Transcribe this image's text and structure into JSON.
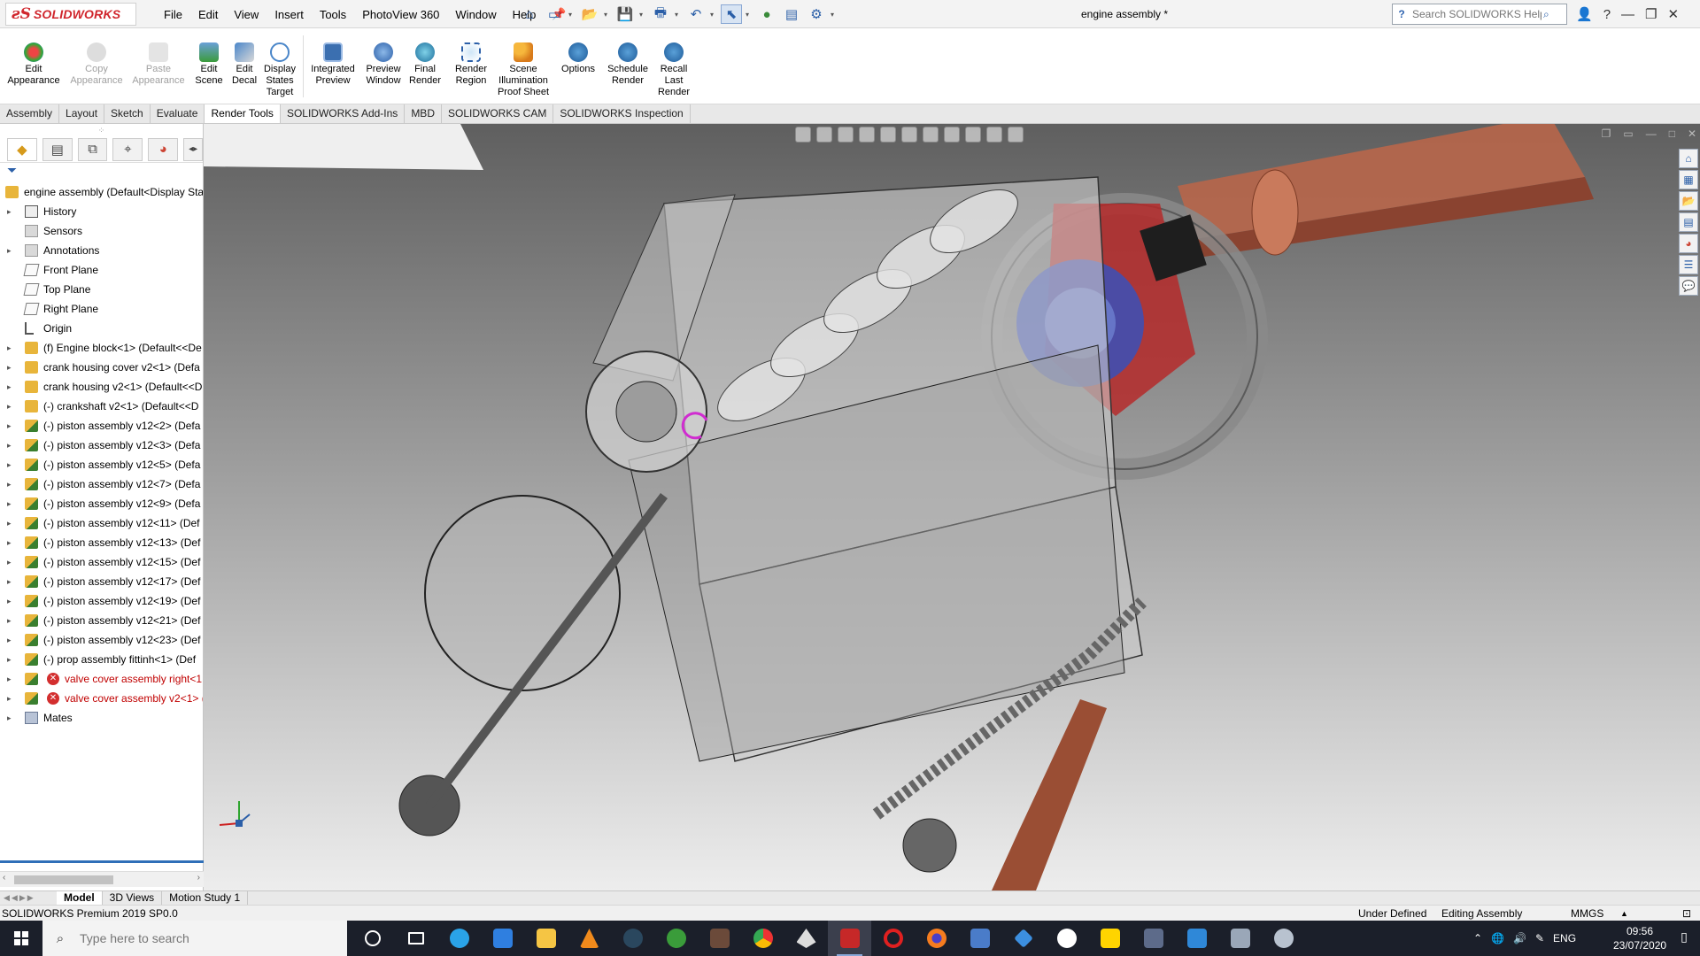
{
  "app": {
    "logo_text": "SOLIDWORKS",
    "menus": [
      "File",
      "Edit",
      "View",
      "Insert",
      "Tools",
      "PhotoView 360",
      "Window",
      "Help"
    ],
    "document_title": "engine assembly *",
    "help_search_placeholder": "Search SOLIDWORKS Help"
  },
  "command_manager": {
    "buttons": [
      {
        "label": "Edit\nAppearance",
        "icon": "edit-appearance-icon",
        "enabled": true
      },
      {
        "label": "Copy\nAppearance",
        "icon": "copy-appearance-icon",
        "enabled": false
      },
      {
        "label": "Paste\nAppearance",
        "icon": "paste-appearance-icon",
        "enabled": false
      },
      {
        "label": "Edit\nScene",
        "icon": "edit-scene-icon",
        "enabled": true
      },
      {
        "label": "Edit\nDecal",
        "icon": "edit-decal-icon",
        "enabled": true
      },
      {
        "label": "Display\nStates\nTarget",
        "icon": "display-states-icon",
        "enabled": true
      },
      {
        "label": "Integrated\nPreview",
        "icon": "integrated-preview-icon",
        "enabled": true
      },
      {
        "label": "Preview\nWindow",
        "icon": "preview-window-icon",
        "enabled": true
      },
      {
        "label": "Final\nRender",
        "icon": "final-render-icon",
        "enabled": true
      },
      {
        "label": "Render\nRegion",
        "icon": "render-region-icon",
        "enabled": true
      },
      {
        "label": "Scene\nIllumination\nProof Sheet",
        "icon": "scene-illumination-icon",
        "enabled": true
      },
      {
        "label": "Options",
        "icon": "options-icon",
        "enabled": true
      },
      {
        "label": "Schedule\nRender",
        "icon": "schedule-render-icon",
        "enabled": true
      },
      {
        "label": "Recall\nLast\nRender",
        "icon": "recall-render-icon",
        "enabled": true
      }
    ]
  },
  "tabs": [
    "Assembly",
    "Layout",
    "Sketch",
    "Evaluate",
    "Render Tools",
    "SOLIDWORKS Add-Ins",
    "MBD",
    "SOLIDWORKS CAM",
    "SOLIDWORKS Inspection"
  ],
  "active_tab": "Render Tools",
  "feature_tree": {
    "root": "engine assembly  (Default<Display Sta",
    "items": [
      {
        "label": "History",
        "icon": "history-icon",
        "expandable": true
      },
      {
        "label": "Sensors",
        "icon": "sensors-icon",
        "expandable": false
      },
      {
        "label": "Annotations",
        "icon": "annotations-icon",
        "expandable": true
      },
      {
        "label": "Front Plane",
        "icon": "plane-icon",
        "expandable": false
      },
      {
        "label": "Top Plane",
        "icon": "plane-icon",
        "expandable": false
      },
      {
        "label": "Right Plane",
        "icon": "plane-icon",
        "expandable": false
      },
      {
        "label": "Origin",
        "icon": "origin-icon",
        "expandable": false
      },
      {
        "label": "(f) Engine block<1> (Default<<De",
        "icon": "part-icon",
        "expandable": true
      },
      {
        "label": "crank housing cover v2<1> (Defa",
        "icon": "part-icon",
        "expandable": true
      },
      {
        "label": "crank housing v2<1> (Default<<D",
        "icon": "part-icon",
        "expandable": true
      },
      {
        "label": "(-) crankshaft v2<1> (Default<<D",
        "icon": "part-icon",
        "expandable": true
      },
      {
        "label": "(-) piston assembly v12<2> (Defa",
        "icon": "subassembly-icon",
        "expandable": true
      },
      {
        "label": "(-) piston assembly v12<3> (Defa",
        "icon": "subassembly-icon",
        "expandable": true
      },
      {
        "label": "(-) piston assembly v12<5> (Defa",
        "icon": "subassembly-icon",
        "expandable": true
      },
      {
        "label": "(-) piston assembly v12<7> (Defa",
        "icon": "subassembly-icon",
        "expandable": true
      },
      {
        "label": "(-) piston assembly v12<9> (Defa",
        "icon": "subassembly-icon",
        "expandable": true
      },
      {
        "label": "(-) piston assembly v12<11> (Def",
        "icon": "subassembly-icon",
        "expandable": true
      },
      {
        "label": "(-) piston assembly v12<13> (Def",
        "icon": "subassembly-icon",
        "expandable": true
      },
      {
        "label": "(-) piston assembly v12<15> (Def",
        "icon": "subassembly-icon",
        "expandable": true
      },
      {
        "label": "(-) piston assembly v12<17> (Def",
        "icon": "subassembly-icon",
        "expandable": true
      },
      {
        "label": "(-) piston assembly v12<19> (Def",
        "icon": "subassembly-icon",
        "expandable": true
      },
      {
        "label": "(-) piston assembly v12<21> (Def",
        "icon": "subassembly-icon",
        "expandable": true
      },
      {
        "label": "(-) piston assembly v12<23> (Def",
        "icon": "subassembly-icon",
        "expandable": true
      },
      {
        "label": "(-) prop assembly fittinh<1> (Def",
        "icon": "subassembly-icon",
        "expandable": true
      },
      {
        "label": "valve cover assembly right<1",
        "icon": "subassembly-icon",
        "expandable": true,
        "error": true
      },
      {
        "label": "valve cover assembly v2<1> (",
        "icon": "subassembly-icon",
        "expandable": true,
        "error": true
      },
      {
        "label": "Mates",
        "icon": "mates-icon",
        "expandable": true
      }
    ]
  },
  "bottom_tabs": [
    "Model",
    "3D Views",
    "Motion Study 1"
  ],
  "active_bottom_tab": "Model",
  "status_bar": {
    "version": "SOLIDWORKS Premium 2019 SP0.0",
    "state": "Under Defined",
    "mode": "Editing Assembly",
    "units": "MMGS"
  },
  "taskbar": {
    "search_placeholder": "Type here to search",
    "language": "ENG",
    "time": "09:56",
    "date": "23/07/2020"
  },
  "colors": {
    "brand_red": "#d0262d",
    "error_red": "#c00000",
    "accent_blue": "#2f6fb8",
    "copper": "#b8664a",
    "taskbar": "#1b1f2a"
  }
}
